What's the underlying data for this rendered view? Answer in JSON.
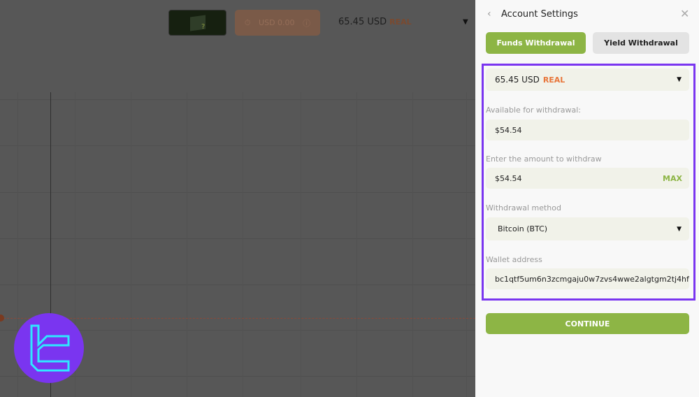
{
  "header": {
    "timer_label": "USD 0.00",
    "account_balance": "65.45 USD",
    "account_type": "REAL"
  },
  "panel": {
    "title": "Account Settings",
    "tabs": [
      {
        "label": "Funds Withdrawal",
        "active": true
      },
      {
        "label": "Yield Withdrawal",
        "active": false
      }
    ],
    "account_select": {
      "balance": "65.45 USD",
      "type": "REAL"
    },
    "available_label": "Available for withdrawal:",
    "available_value": "$54.54",
    "amount_label": "Enter the amount to withdraw",
    "amount_value": "$54.54",
    "max_label": "MAX",
    "method_label": "Withdrawal method",
    "method_value": "Bitcoin (BTC)",
    "wallet_label": "Wallet address",
    "wallet_value": "bc1qtf5um6n3zcmgaju0w7zvs4wwe2algtgm2tj4hf",
    "continue_label": "CONTINUE"
  },
  "colors": {
    "accent": "#8db545",
    "real": "#e8763a",
    "highlight": "#7a35f0"
  }
}
